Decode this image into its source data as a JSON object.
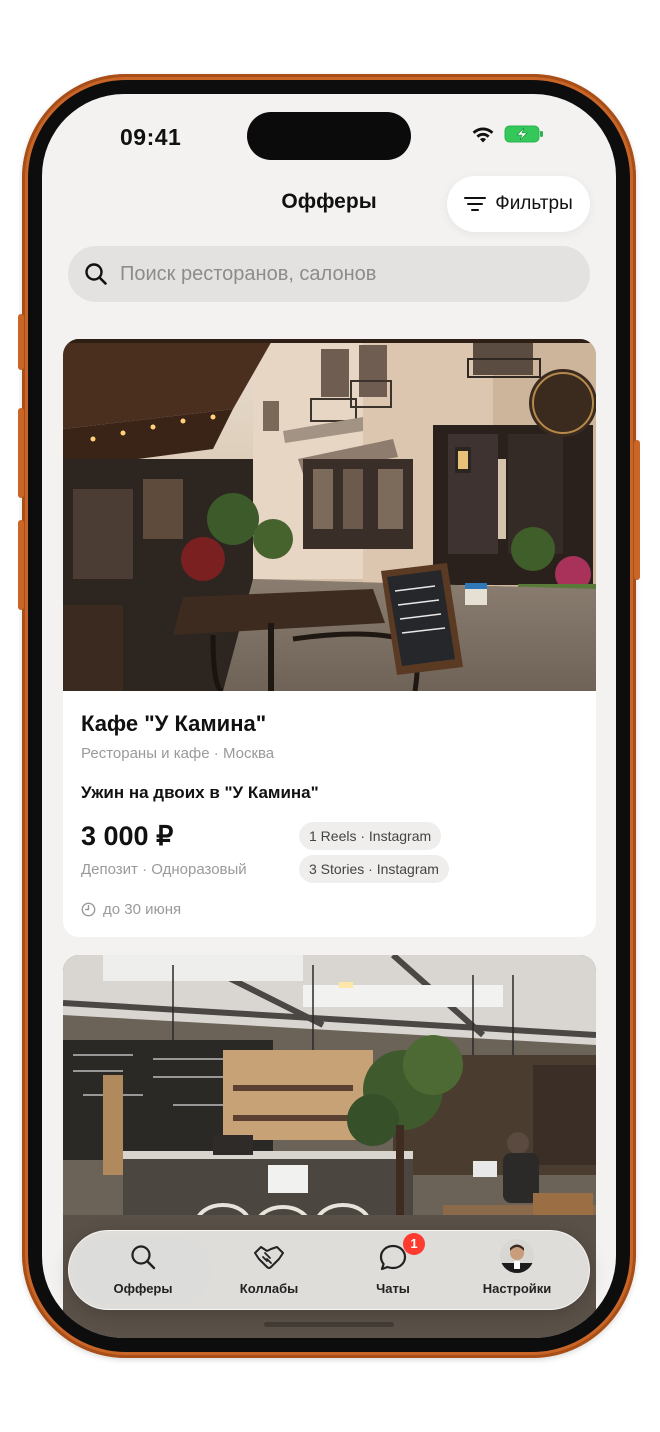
{
  "status_bar": {
    "time": "09:41"
  },
  "header": {
    "title": "Офферы",
    "filter_label": "Фильтры"
  },
  "search": {
    "placeholder": "Поиск ресторанов, салонов",
    "value": ""
  },
  "offers": [
    {
      "name": "Кафе \"У Камина\"",
      "subtitle": "Рестораны и кафе · Москва",
      "offer_title": "Ужин на двоих в \"У Камина\"",
      "price": "3 000 ₽",
      "deposit": "Депозит · Одноразовый",
      "tags": [
        "1 Reels · Instagram",
        "3 Stories · Instagram"
      ],
      "deadline": "до 30 июня",
      "photo": "street-cafe-terrace"
    },
    {
      "photo": "cafe-interior"
    }
  ],
  "tabbar": {
    "tabs": [
      {
        "label": "Офферы",
        "icon": "search-icon",
        "active": true
      },
      {
        "label": "Коллабы",
        "icon": "handshake-icon"
      },
      {
        "label": "Чаты",
        "icon": "chat-bubble-icon",
        "badge": "1"
      },
      {
        "label": "Настройки",
        "icon": "avatar"
      }
    ]
  },
  "colors": {
    "frame": "#c96526",
    "background": "#f3f2f0",
    "badge": "#ff3b30"
  }
}
